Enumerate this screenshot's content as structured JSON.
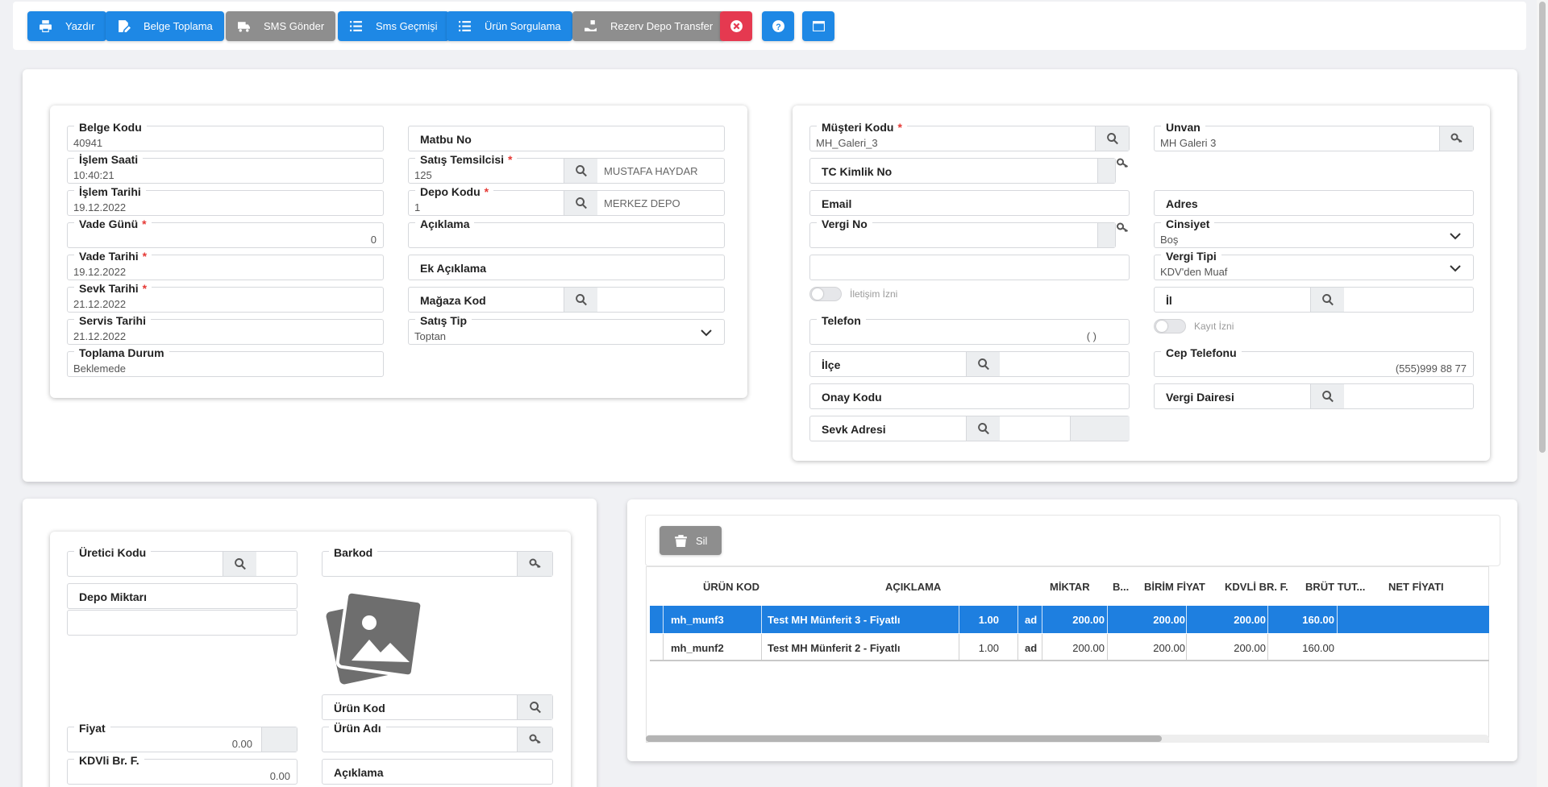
{
  "toolbar": {
    "print": "Yazdır",
    "collect": "Belge Toplama",
    "sms": "SMS Gönder",
    "sms_history": "Sms Geçmişi",
    "product_query": "Ürün Sorgulama",
    "transfer": "Rezerv Depo Transfer"
  },
  "doc": {
    "belge_kodu": {
      "label": "Belge Kodu",
      "value": "40941"
    },
    "islem_saati": {
      "label": "İşlem Saati",
      "value": "10:40:21"
    },
    "islem_tarihi": {
      "label": "İşlem Tarihi",
      "value": "19.12.2022"
    },
    "vade_gunu": {
      "label": "Vade Günü",
      "value": "0"
    },
    "vade_tarihi": {
      "label": "Vade Tarihi",
      "value": "19.12.2022"
    },
    "sevk_tarihi": {
      "label": "Sevk Tarihi",
      "value": "21.12.2022"
    },
    "servis_tarihi": {
      "label": "Servis Tarihi",
      "value": "21.12.2022"
    },
    "toplama_durum": {
      "label": "Toplama Durum",
      "value": "Beklemede"
    },
    "matbu_no": {
      "label": "Matbu No"
    },
    "satis_temsilcisi": {
      "label": "Satış Temsilcisi",
      "value": "125",
      "name": "MUSTAFA HAYDAR"
    },
    "depo_kodu": {
      "label": "Depo Kodu",
      "value": "1",
      "name": "MERKEZ DEPO"
    },
    "aciklama": {
      "label": "Açıklama"
    },
    "ek_aciklama": {
      "label": "Ek Açıklama"
    },
    "magaza_kod": {
      "label": "Mağaza Kod"
    },
    "satis_tip": {
      "label": "Satış Tip",
      "value": "Toptan"
    }
  },
  "customer": {
    "musteri_kodu": {
      "label": "Müşteri Kodu",
      "value": "MH_Galeri_3"
    },
    "unvan": {
      "label": "Unvan",
      "value": "MH Galeri 3"
    },
    "tc": {
      "label": "TC Kimlik No"
    },
    "email": {
      "label": "Email"
    },
    "adres": {
      "label": "Adres"
    },
    "vergi_no": {
      "label": "Vergi No"
    },
    "cinsiyet": {
      "label": "Cinsiyet",
      "value": "Boş"
    },
    "vergi_tipi": {
      "label": "Vergi Tipi",
      "value": "KDV'den Muaf"
    },
    "iletisim": "İletişim İzni",
    "il": {
      "label": "İl"
    },
    "telefon": {
      "label": "Telefon",
      "value": "(  )"
    },
    "kayit": "Kayıt İzni",
    "ilce": {
      "label": "İlçe"
    },
    "cep": {
      "label": "Cep Telefonu",
      "value": "(555)999 88 77"
    },
    "onay": {
      "label": "Onay Kodu"
    },
    "vergi_dairesi": {
      "label": "Vergi Dairesi"
    },
    "sevk_adresi": {
      "label": "Sevk Adresi"
    }
  },
  "product": {
    "uretici_kodu": "Üretici Kodu",
    "barkod": "Barkod",
    "depo_miktari": "Depo Miktarı",
    "urun_kod": "Ürün Kod",
    "urun_adi": "Ürün Adı",
    "fiyat": {
      "label": "Fiyat",
      "value": "0.00"
    },
    "kdvli": {
      "label": "KDVli Br. F.",
      "value": "0.00"
    },
    "aciklama": "Açıklama"
  },
  "grid": {
    "delete": "Sil",
    "headers": [
      "ÜRÜN KOD",
      "AÇIKLAMA",
      "MİKTAR",
      "B...",
      "BİRİM FİYAT",
      "KDVLİ BR. F.",
      "BRÜT TUT...",
      "NET FİYATI"
    ],
    "rows": [
      {
        "kod": "mh_munf3",
        "aciklama": "Test MH Münferit 3 - Fiyatlı",
        "miktar": "1.00",
        "birim": "ad",
        "birim_fiyat": "200.00",
        "kdvli": "200.00",
        "brut": "200.00",
        "net": "160.00"
      },
      {
        "kod": "mh_munf2",
        "aciklama": "Test MH Münferit 2 - Fiyatlı",
        "miktar": "1.00",
        "birim": "ad",
        "birim_fiyat": "200.00",
        "kdvli": "200.00",
        "brut": "200.00",
        "net": "160.00"
      }
    ]
  }
}
